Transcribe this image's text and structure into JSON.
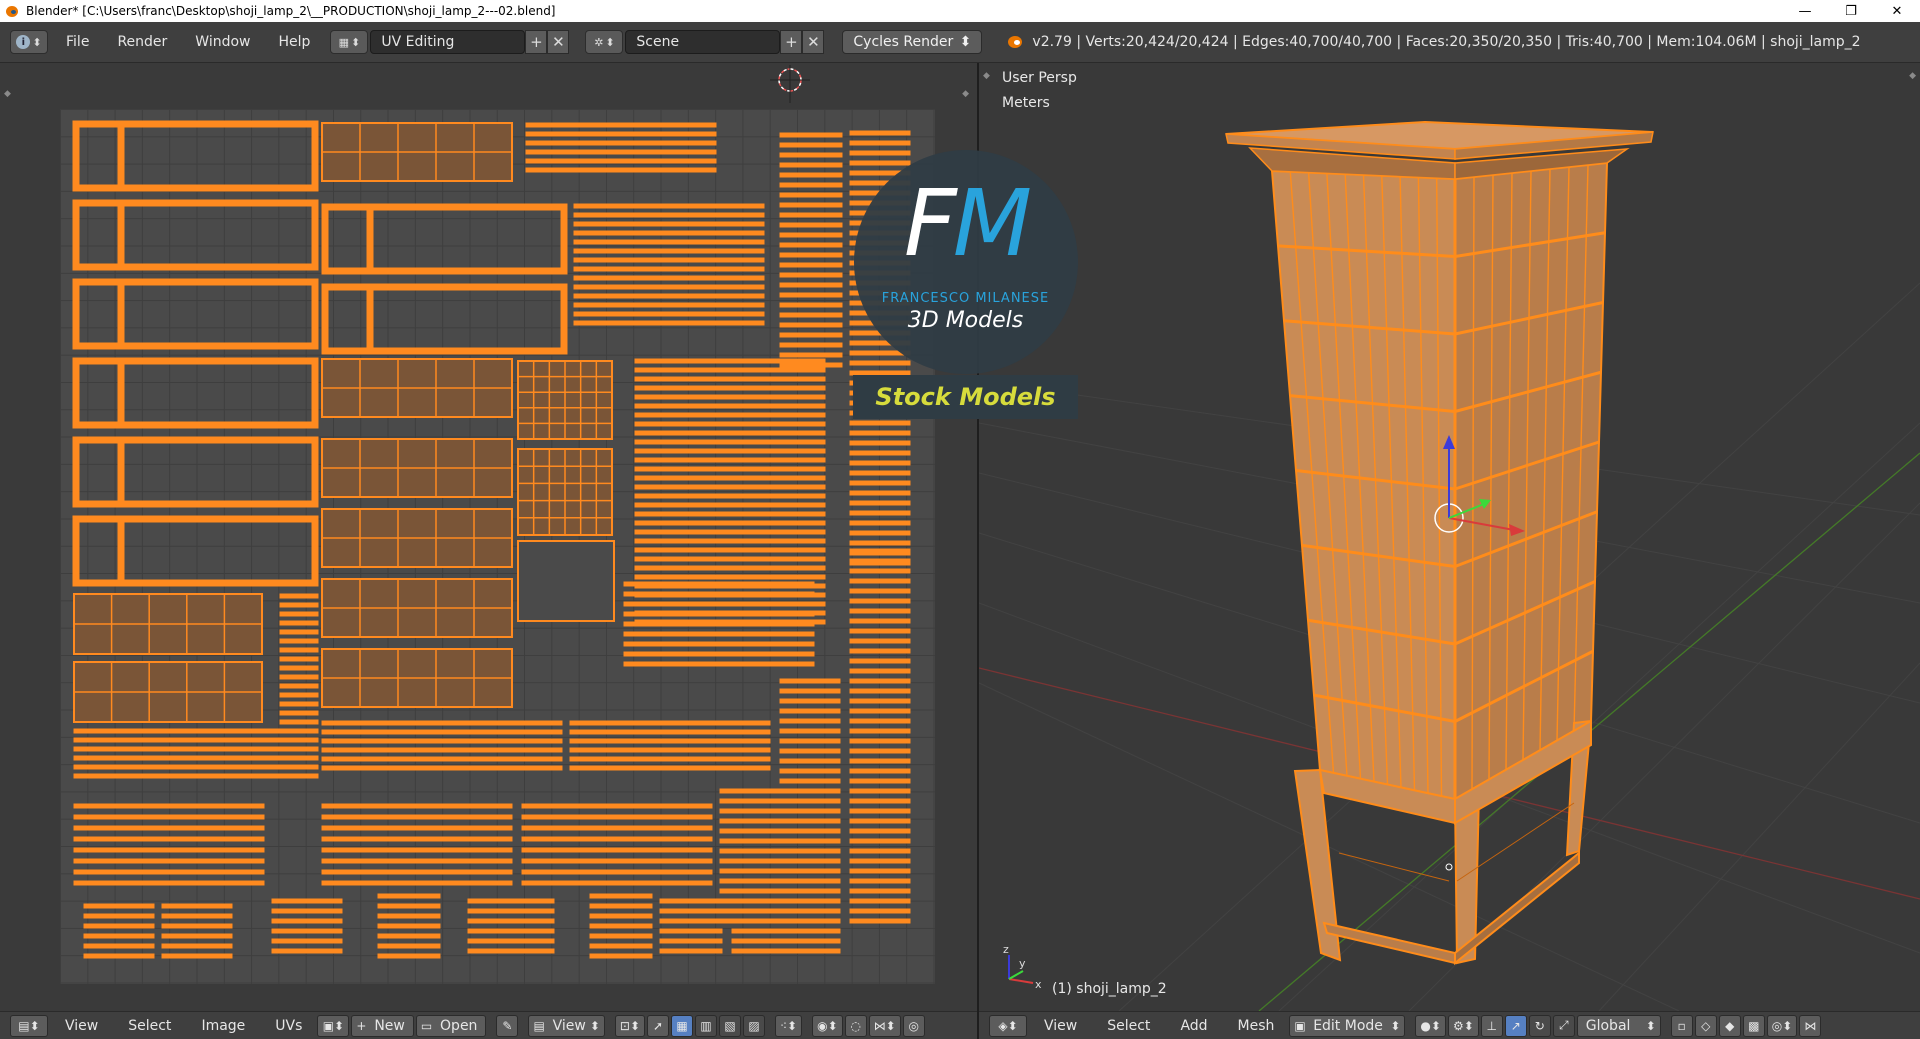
{
  "titlebar": {
    "title": "Blender* [C:\\Users\\franc\\Desktop\\shoji_lamp_2\\__PRODUCTION\\shoji_lamp_2---02.blend]",
    "minimize": "—",
    "maximize": "❐",
    "close": "✕"
  },
  "info_header": {
    "editor_icon": "info-icon",
    "menus": [
      "File",
      "Render",
      "Window",
      "Help"
    ],
    "screen_layout": "UV Editing",
    "scene": "Scene",
    "render_engine": "Cycles Render",
    "stats": "v2.79 | Verts:20,424/20,424 | Edges:40,700/40,700 | Faces:20,350/20,350 | Tris:40,700 | Mem:104.06M | shoji_lamp_2"
  },
  "uv_editor": {
    "grid_color": "#4a4a4a",
    "island_color": "#ff8a1f"
  },
  "viewport": {
    "view_name": "User Persp",
    "units": "Meters",
    "object_label": "(1) shoji_lamp_2",
    "wire_color": "#ff8c1a",
    "fill_color": "#c98b55"
  },
  "watermark": {
    "letter_f": "F",
    "letter_m": "M",
    "name": "FRANCESCO MILANESE",
    "subtitle": "3D Models",
    "stock": "Stock Models"
  },
  "uv_footer": {
    "menus": [
      "View",
      "Select",
      "Image",
      "UVs"
    ],
    "new_label": "New",
    "open_label": "Open",
    "view_label": "View"
  },
  "viewport_footer": {
    "menus": [
      "View",
      "Select",
      "Add",
      "Mesh"
    ],
    "mode": "Edit Mode",
    "orientation": "Global"
  }
}
